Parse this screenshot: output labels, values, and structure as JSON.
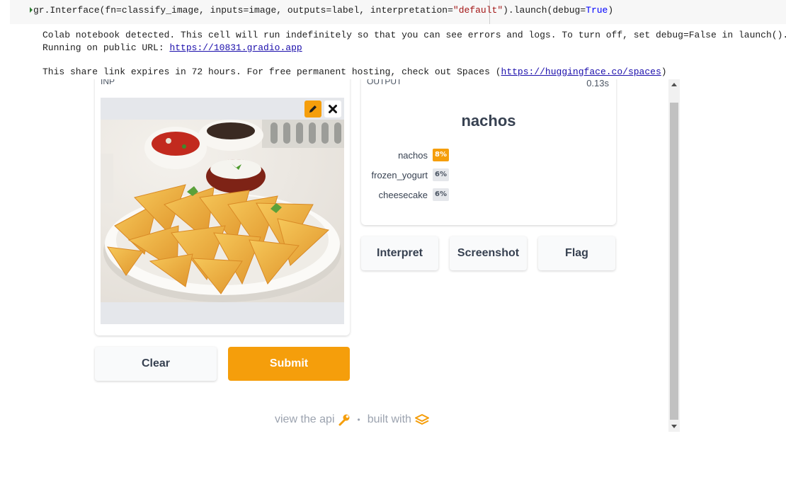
{
  "notebook": {
    "code": {
      "before_string": "gr.Interface(fn=classify_image, inputs=image, outputs=label, interpretation=",
      "string_literal": "\"default\"",
      "middle": ").launch(debug=",
      "keyword": "True",
      "after": ")"
    },
    "output": {
      "line1": "Colab notebook detected. This cell will run indefinitely so that you can see errors and logs. To turn off, set debug=False in launch().",
      "line2_prefix": "Running on public URL: ",
      "public_url": "https://10831.gradio.app",
      "line3_prefix": "This share link expires in 72 hours. For free permanent hosting, check out Spaces (",
      "spaces_url": "https://huggingface.co/spaces",
      "line3_suffix": ")"
    }
  },
  "interface": {
    "input_label": "INP",
    "output_label": "OUTPUT",
    "elapsed_time": "0.13s",
    "predicted_label": "nachos",
    "confidences": [
      {
        "label": "nachos",
        "percent": "8%",
        "value": 0.08,
        "top": true
      },
      {
        "label": "frozen_yogurt",
        "percent": "6%",
        "value": 0.06,
        "top": false
      },
      {
        "label": "cheesecake",
        "percent": "6%",
        "value": 0.06,
        "top": false
      }
    ],
    "buttons": {
      "clear": "Clear",
      "submit": "Submit",
      "interpret": "Interpret",
      "screenshot": "Screenshot",
      "flag": "Flag"
    },
    "footer": {
      "api_text": "view the api",
      "built_text": "built with"
    }
  },
  "colors": {
    "accent": "#f59e0b",
    "text": "#374151",
    "muted": "#9ca3af"
  },
  "icons": [
    "pencil-icon",
    "close-icon",
    "wrench-icon",
    "gradio-logo-icon"
  ]
}
